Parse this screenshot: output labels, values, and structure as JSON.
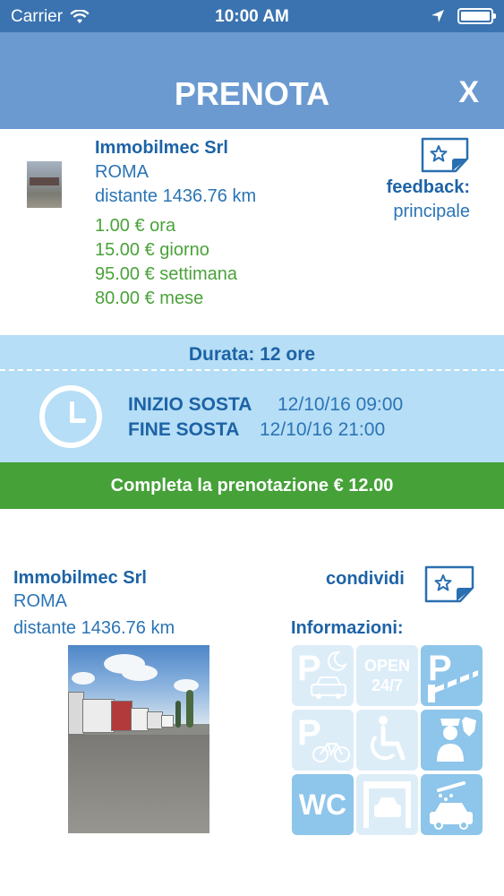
{
  "status_bar": {
    "carrier": "Carrier",
    "time": "10:00 AM"
  },
  "header": {
    "title": "PRENOTA",
    "close_label": "X"
  },
  "listing": {
    "name": "Immobilmec Srl",
    "city": "ROMA",
    "distance": "distante 1436.76 km",
    "prices": [
      "1.00 € ora",
      "15.00 € giorno",
      "95.00 € settimana",
      "80.00 € mese"
    ],
    "feedback_label": "feedback:",
    "feedback_value": "principale"
  },
  "duration": {
    "title": "Durata: 12 ore",
    "start_label": "INIZIO SOSTA",
    "start_value": "12/10/16 09:00",
    "end_label": "FINE SOSTA",
    "end_value": "12/10/16 21:00"
  },
  "complete_button": "Completa la prenotazione € 12.00",
  "details": {
    "name": "Immobilmec Srl",
    "city": "ROMA",
    "distance": "distante 1436.76 km",
    "share_label": "condividi",
    "info_label": "Informazioni:",
    "tiles": [
      {
        "icon": "night-parking-icon",
        "active": false,
        "text": "P"
      },
      {
        "icon": "open-24-7-icon",
        "active": false,
        "text": "OPEN 24/7"
      },
      {
        "icon": "barrier-parking-icon",
        "active": true,
        "text": "P"
      },
      {
        "icon": "bike-parking-icon",
        "active": false,
        "text": "P"
      },
      {
        "icon": "wheelchair-icon",
        "active": false,
        "text": ""
      },
      {
        "icon": "security-guard-icon",
        "active": true,
        "text": ""
      },
      {
        "icon": "wc-icon",
        "active": true,
        "text": "WC"
      },
      {
        "icon": "covered-parking-icon",
        "active": false,
        "text": ""
      },
      {
        "icon": "car-wash-icon",
        "active": true,
        "text": ""
      }
    ]
  },
  "colors": {
    "primary": "#1d63a6",
    "price_green": "#4aa23a",
    "header_blue": "#6b9ad1",
    "duration_bg": "#b6def6",
    "button_green": "#45a138"
  }
}
